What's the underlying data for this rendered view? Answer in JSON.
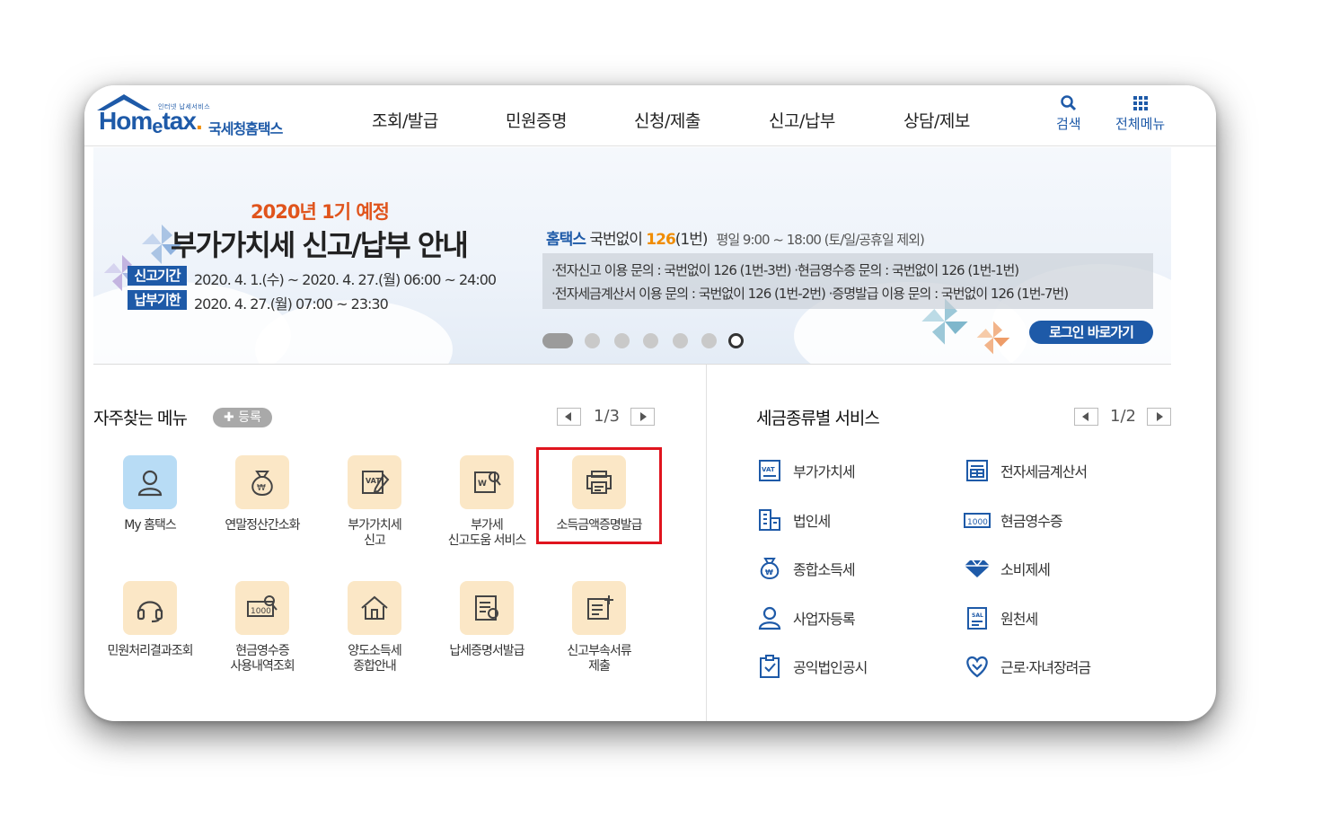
{
  "header": {
    "logo_small": "인터넷 납세서비스",
    "logo_word_hom": "Hom",
    "logo_word_e": "e",
    "logo_word_tax": "tax",
    "logo_dot": ".",
    "logo_kr": "국세청홈택스",
    "nav": [
      "조회/발급",
      "민원증명",
      "신청/제출",
      "신고/납부",
      "상담/제보"
    ],
    "search_label": "검색",
    "menu_label": "전체메뉴"
  },
  "banner": {
    "year": "2020년 1기 예정",
    "title": "부가가치세 신고/납부 안내",
    "tag1": "신고기간",
    "date1": "2020. 4. 1.(수) ~ 2020. 4. 27.(월) 06:00 ~ 24:00",
    "tag2": "납부기한",
    "date2": "2020. 4. 27.(월) 07:00 ~ 23:30",
    "hometax": "홈택스",
    "phone_prefix": " 국번없이 ",
    "phone_num": "126",
    "phone_suffix": "(1번)",
    "hours": "평일 9:00 ~ 18:00 (토/일/공휴일 제외)",
    "info1": "·전자신고 이용 문의 : 국번없이 126 (1번-3번)   ·현금영수증 문의 : 국번없이 126 (1번-1번)",
    "info2": "·전자세금계산서 이용 문의 : 국번없이 126 (1번-2번)   ·증명발급 이용 문의 : 국번없이 126 (1번-7번)",
    "login_button": "로그인 바로가기",
    "slide_count": 7,
    "active_slide": 7
  },
  "favorites": {
    "title": "자주찾는 메뉴",
    "register": "✚ 등록",
    "page": "1/3",
    "items": [
      {
        "label": "My 홈택스",
        "icon": "user-icon"
      },
      {
        "label": "연말정산간소화",
        "icon": "money-bag-icon"
      },
      {
        "label": "부가가치세\n신고",
        "icon": "vat-document-icon"
      },
      {
        "label": "부가세\n신고도움 서비스",
        "icon": "document-search-icon"
      },
      {
        "label": "소득금액증명발급",
        "icon": "printer-icon"
      },
      {
        "label": "민원처리결과조회",
        "icon": "headset-icon"
      },
      {
        "label": "현금영수증\n사용내역조회",
        "icon": "receipt-search-icon"
      },
      {
        "label": "양도소득세\n종합안내",
        "icon": "house-icon"
      },
      {
        "label": "납세증명서발급",
        "icon": "certificate-icon"
      },
      {
        "label": "신고부속서류\n제출",
        "icon": "document-add-icon"
      }
    ]
  },
  "services": {
    "title": "세금종류별 서비스",
    "page": "1/2",
    "items": [
      {
        "label": "부가가치세",
        "icon": "vat-icon"
      },
      {
        "label": "전자세금계산서",
        "icon": "invoice-icon"
      },
      {
        "label": "법인세",
        "icon": "building-icon"
      },
      {
        "label": "현금영수증",
        "icon": "cash-receipt-icon"
      },
      {
        "label": "종합소득세",
        "icon": "money-bag-icon"
      },
      {
        "label": "소비제세",
        "icon": "diamond-icon"
      },
      {
        "label": "사업자등록",
        "icon": "person-icon"
      },
      {
        "label": "원천세",
        "icon": "salary-icon"
      },
      {
        "label": "공익법인공시",
        "icon": "clipboard-icon"
      },
      {
        "label": "근로·자녀장려금",
        "icon": "heart-icon"
      }
    ]
  },
  "colors": {
    "brand_blue": "#1e5aa8",
    "accent_orange": "#e0541c",
    "highlight_red": "#e0141e",
    "tile_bg": "#fbe7c6"
  }
}
